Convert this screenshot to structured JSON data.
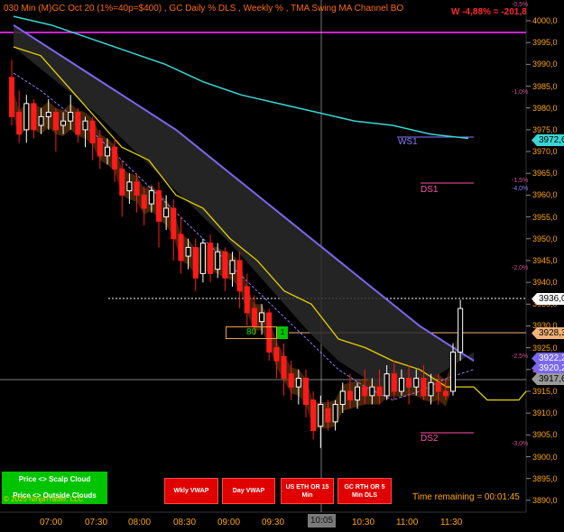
{
  "header": {
    "title": "030 Min (M)GC  Oct 20 (1%=40p=$400) , GC Daily % DLS , Weekly % , TMA Swing MA Channel BO",
    "weekly_change": "W -4,88% = -201,8"
  },
  "price_axis": {
    "labels": [
      "4000,0",
      "3995,0",
      "3990,0",
      "3985,0",
      "3980,0",
      "3975,0",
      "3970,0",
      "3965,0",
      "3960,0",
      "3955,0",
      "3950,0",
      "3945,0",
      "3940,0",
      "3935,0",
      "3930,0",
      "3925,0",
      "3920,0",
      "3915,0",
      "3910,0",
      "3905,0",
      "3900,0",
      "3895,0",
      "3890,0"
    ]
  },
  "time_axis": {
    "labels": [
      "07:00",
      "07:30",
      "08:00",
      "08:30",
      "09:00",
      "09:30",
      "10:30",
      "11:00",
      "11:30"
    ],
    "crosshair_label": "10:05"
  },
  "price_badges": [
    {
      "text": "3972,6",
      "bg": "#3ad6d6",
      "fg": "#000000"
    },
    {
      "text": "3936,0",
      "bg": "#ffffff",
      "fg": "#000000"
    },
    {
      "text": "3928,3",
      "bg": "#f2b27a",
      "fg": "#000000"
    },
    {
      "text": "3922,2",
      "bg": "#7b68ee",
      "fg": "#ffffff"
    },
    {
      "text": "3920,2",
      "bg": "#7b68ee",
      "fg": "#ffffff"
    },
    {
      "text": "3917,6",
      "bg": "#9a9a9a",
      "fg": "#000000"
    }
  ],
  "percent_labels": [
    {
      "text": "-0,5%"
    },
    {
      "text": "-1,0%"
    },
    {
      "text": "-1,5%"
    },
    {
      "text": "-4,0%"
    },
    {
      "text": "-2,0%"
    },
    {
      "text": "-2,5%"
    },
    {
      "text": "-3,0%"
    }
  ],
  "levels": {
    "ws1": "WS1",
    "ds1": "DS1",
    "ds2": "DS2"
  },
  "order_box": {
    "qty": "80",
    "mark": "1"
  },
  "buttons": {
    "scalp_cloud": "Price <> Scalp Cloud",
    "outside_clouds": "Price <> Outside Clouds",
    "wkly_vwap": "Wkly VWAP",
    "day_vwap": "Day VWAP",
    "us_eth": "US ETH OR 15 Min",
    "gc_rth": "GC RTH OR 5 Min DLS"
  },
  "copyright": "© 2025 NinjaTrader, LLC",
  "time_remaining": "Time remaining = 00:01:45",
  "colors": {
    "up": "#ffffff",
    "down": "#ff1a1a",
    "tma_band": "#7b68ee",
    "yellow": "#e6d200",
    "cyan": "#3ad6d6",
    "magenta": "#cc22cc",
    "cloud": "#7a4510"
  },
  "chart_data": {
    "type": "candlestick",
    "ylim": [
      3887,
      4004
    ],
    "candles": [
      {
        "o": 3987,
        "h": 3991,
        "c": 3978,
        "l": 3976
      },
      {
        "o": 3979,
        "h": 3984,
        "c": 3974,
        "l": 3972
      },
      {
        "o": 3975,
        "h": 3983,
        "c": 3981,
        "l": 3972
      },
      {
        "o": 3981,
        "h": 3982,
        "c": 3975,
        "l": 3973
      },
      {
        "o": 3976,
        "h": 3980,
        "c": 3978,
        "l": 3974
      },
      {
        "o": 3978,
        "h": 3982,
        "c": 3979,
        "l": 3975
      },
      {
        "o": 3979,
        "h": 3980,
        "c": 3975,
        "l": 3970
      },
      {
        "o": 3976,
        "h": 3979,
        "c": 3977,
        "l": 3974
      },
      {
        "o": 3977,
        "h": 3983,
        "c": 3979,
        "l": 3975
      },
      {
        "o": 3979,
        "h": 3980,
        "c": 3974,
        "l": 3972
      },
      {
        "o": 3975,
        "h": 3978,
        "c": 3977,
        "l": 3971
      },
      {
        "o": 3977,
        "h": 3978,
        "c": 3972,
        "l": 3968
      },
      {
        "o": 3973,
        "h": 3975,
        "c": 3969,
        "l": 3966
      },
      {
        "o": 3969,
        "h": 3973,
        "c": 3971,
        "l": 3967
      },
      {
        "o": 3971,
        "h": 3973,
        "c": 3966,
        "l": 3963
      },
      {
        "o": 3966,
        "h": 3968,
        "c": 3960,
        "l": 3955
      },
      {
        "o": 3961,
        "h": 3965,
        "c": 3963,
        "l": 3958
      },
      {
        "o": 3963,
        "h": 3965,
        "c": 3960,
        "l": 3956
      },
      {
        "o": 3960,
        "h": 3962,
        "c": 3957,
        "l": 3953
      },
      {
        "o": 3958,
        "h": 3962,
        "c": 3961,
        "l": 3956
      },
      {
        "o": 3961,
        "h": 3963,
        "c": 3954,
        "l": 3948
      },
      {
        "o": 3955,
        "h": 3960,
        "c": 3957,
        "l": 3952
      },
      {
        "o": 3957,
        "h": 3959,
        "c": 3950,
        "l": 3945
      },
      {
        "o": 3951,
        "h": 3955,
        "c": 3945,
        "l": 3942
      },
      {
        "o": 3946,
        "h": 3950,
        "c": 3948,
        "l": 3943
      },
      {
        "o": 3948,
        "h": 3950,
        "c": 3941,
        "l": 3938
      },
      {
        "o": 3942,
        "h": 3950,
        "c": 3949,
        "l": 3940
      },
      {
        "o": 3949,
        "h": 3951,
        "c": 3942,
        "l": 3940
      },
      {
        "o": 3943,
        "h": 3949,
        "c": 3947,
        "l": 3941
      },
      {
        "o": 3947,
        "h": 3948,
        "c": 3941,
        "l": 3938
      },
      {
        "o": 3942,
        "h": 3947,
        "c": 3945,
        "l": 3939
      },
      {
        "o": 3945,
        "h": 3947,
        "c": 3938,
        "l": 3934
      },
      {
        "o": 3939,
        "h": 3942,
        "c": 3933,
        "l": 3930
      },
      {
        "o": 3934,
        "h": 3937,
        "c": 3930,
        "l": 3928
      },
      {
        "o": 3931,
        "h": 3935,
        "c": 3933,
        "l": 3928
      },
      {
        "o": 3933,
        "h": 3934,
        "c": 3924,
        "l": 3922
      },
      {
        "o": 3925,
        "h": 3928,
        "c": 3922,
        "l": 3918
      },
      {
        "o": 3923,
        "h": 3926,
        "c": 3918,
        "l": 3914
      },
      {
        "o": 3919,
        "h": 3922,
        "c": 3916,
        "l": 3913
      },
      {
        "o": 3916,
        "h": 3920,
        "c": 3918,
        "l": 3912
      },
      {
        "o": 3918,
        "h": 3920,
        "c": 3912,
        "l": 3909
      },
      {
        "o": 3913,
        "h": 3915,
        "c": 3906,
        "l": 3904
      },
      {
        "o": 3907,
        "h": 3914,
        "c": 3912,
        "l": 3902
      },
      {
        "o": 3911,
        "h": 3913,
        "c": 3908,
        "l": 3906
      },
      {
        "o": 3908,
        "h": 3913,
        "c": 3912,
        "l": 3906
      },
      {
        "o": 3912,
        "h": 3917,
        "c": 3915,
        "l": 3910
      },
      {
        "o": 3915,
        "h": 3919,
        "c": 3913,
        "l": 3911
      },
      {
        "o": 3913,
        "h": 3917,
        "c": 3916,
        "l": 3911
      },
      {
        "o": 3916,
        "h": 3920,
        "c": 3914,
        "l": 3912
      },
      {
        "o": 3914,
        "h": 3918,
        "c": 3916,
        "l": 3912
      },
      {
        "o": 3916,
        "h": 3920,
        "c": 3914,
        "l": 3912
      },
      {
        "o": 3914,
        "h": 3921,
        "c": 3919,
        "l": 3913
      },
      {
        "o": 3919,
        "h": 3922,
        "c": 3915,
        "l": 3913
      },
      {
        "o": 3915,
        "h": 3920,
        "c": 3918,
        "l": 3914
      },
      {
        "o": 3918,
        "h": 3921,
        "c": 3916,
        "l": 3912
      },
      {
        "o": 3916,
        "h": 3920,
        "c": 3918,
        "l": 3914
      },
      {
        "o": 3918,
        "h": 3921,
        "c": 3914,
        "l": 3913
      },
      {
        "o": 3914,
        "h": 3919,
        "c": 3917,
        "l": 3912
      },
      {
        "o": 3917,
        "h": 3919,
        "c": 3915,
        "l": 3912
      },
      {
        "o": 3915,
        "h": 3918,
        "c": 3914,
        "l": 3913
      },
      {
        "o": 3915,
        "h": 3926,
        "c": 3924,
        "l": 3914
      },
      {
        "o": 3924,
        "h": 3936,
        "c": 3934,
        "l": 3922
      }
    ],
    "series": [
      {
        "name": "TMA Upper",
        "values": [
          3999,
          3995,
          3991,
          3987,
          3983,
          3979,
          3975,
          3970,
          3965,
          3960,
          3955,
          3950,
          3945,
          3940,
          3935,
          3930,
          3926,
          3922
        ]
      },
      {
        "name": "TMA Middle",
        "values": [
          3988,
          3984,
          3979,
          3974,
          3968,
          3962,
          3956,
          3950,
          3944,
          3938,
          3932,
          3926,
          3920,
          3916,
          3913,
          3915,
          3918,
          3920
        ]
      },
      {
        "name": "Yellow MA",
        "values": [
          3994,
          3992,
          3985,
          3978,
          3971,
          3968,
          3960,
          3957,
          3950,
          3945,
          3938,
          3935,
          3927,
          3925,
          3922,
          3920,
          3916,
          3916
        ]
      },
      {
        "name": "Cyan MA",
        "values": [
          4001,
          3999,
          3996,
          3993,
          3990,
          3986,
          3983,
          3981,
          3979,
          3977,
          3976,
          3974,
          3973
        ]
      }
    ]
  }
}
